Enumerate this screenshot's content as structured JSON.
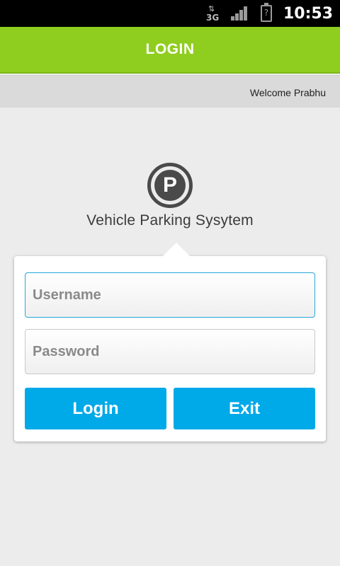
{
  "status_bar": {
    "network": "3G",
    "battery": "?",
    "time": "10:53"
  },
  "header": {
    "title": "LOGIN",
    "color": "#8fce1e"
  },
  "welcome": {
    "text": "Welcome Prabhu"
  },
  "logo": {
    "letter": "P",
    "icon": "parking-icon"
  },
  "app_name": "Vehicle Parking Sysytem",
  "form": {
    "username": {
      "value": "",
      "placeholder": "Username"
    },
    "password": {
      "value": "",
      "placeholder": "Password"
    },
    "login_label": "Login",
    "exit_label": "Exit",
    "button_color": "#00a9e8"
  }
}
